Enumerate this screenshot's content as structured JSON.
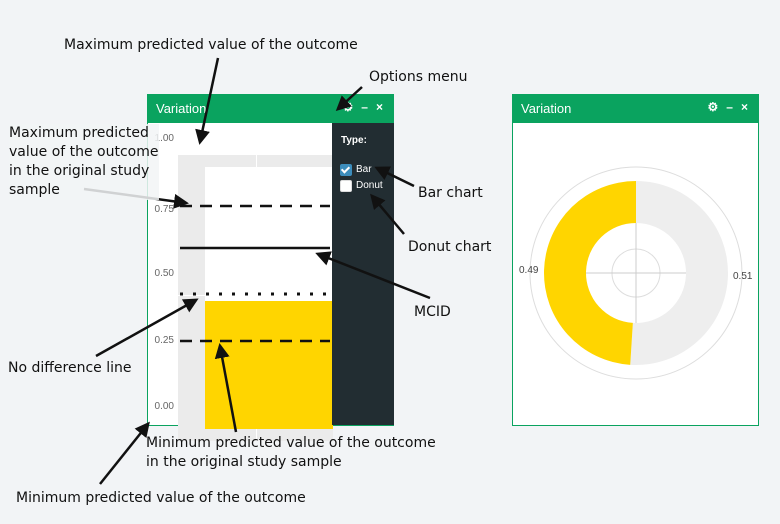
{
  "left_panel": {
    "title": "Variation",
    "icons": [
      "gears-icon",
      "minimize-icon",
      "close-icon"
    ],
    "minimize_glyph": "–",
    "close_glyph": "×",
    "y_ticks": [
      "1.00",
      "0.75",
      "0.50",
      "0.25",
      "0.00"
    ],
    "bar_value": 0.49,
    "mcid": 0.59,
    "no_difference": 0.42,
    "min_original": 0.25,
    "max_original": 0.75,
    "options": {
      "type_label": "Type:",
      "items": [
        {
          "label": "Bar",
          "checked": true
        },
        {
          "label": "Donut",
          "checked": false
        }
      ]
    }
  },
  "right_panel": {
    "title": "Variation",
    "left_value": "0.49",
    "right_value": "0.51"
  },
  "annotations": {
    "max_predicted": "Maximum predicted value of the outcome",
    "options_menu": "Options menu",
    "max_original_l1": "Maximum predicted",
    "max_original_l2": "value of the outcome",
    "max_original_l3": "in the original study",
    "max_original_l4": "sample",
    "bar_chart": "Bar chart",
    "donut_chart": "Donut chart",
    "mcid": "MCID",
    "no_difference": "No difference line",
    "min_original_l1": "Minimum predicted value of the outcome",
    "min_original_l2": "in the original study sample",
    "min_predicted": "Minimum predicted value of the outcome"
  },
  "colors": {
    "header_green": "#0aa35f",
    "bar_yellow": "#ffd500",
    "menu_dark": "#222d32",
    "donut_grey": "#eeeeee"
  }
}
